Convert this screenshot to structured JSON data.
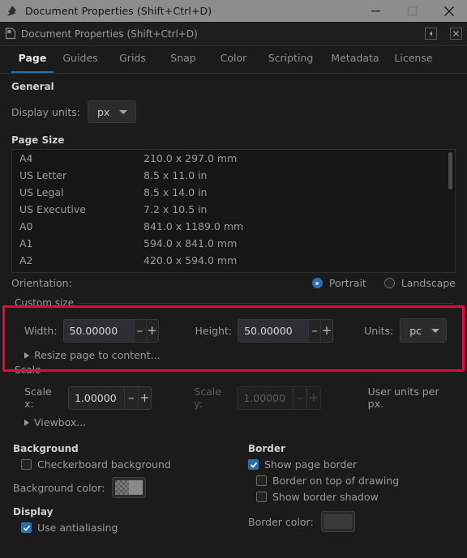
{
  "window": {
    "title": "Document Properties (Shift+Ctrl+D)",
    "icon": "inkscape-logo-icon",
    "minimize_label": "Minimize",
    "maximize_label": "Maximize",
    "close_label": "Close"
  },
  "dialog_header": {
    "icon": "document-properties-icon",
    "title": "Document Properties (Shift+Ctrl+D)",
    "dock_button": "collapse-panel-icon",
    "close_button": "close-panel-icon"
  },
  "tabs": [
    {
      "label": "Page",
      "active": true
    },
    {
      "label": "Guides",
      "active": false
    },
    {
      "label": "Grids",
      "active": false
    },
    {
      "label": "Snap",
      "active": false
    },
    {
      "label": "Color",
      "active": false
    },
    {
      "label": "Scripting",
      "active": false
    },
    {
      "label": "Metadata",
      "active": false
    },
    {
      "label": "License",
      "active": false
    }
  ],
  "general": {
    "title": "General",
    "display_units_label": "Display units:",
    "display_units_value": "px"
  },
  "page_size": {
    "title": "Page Size",
    "rows": [
      {
        "name": "A4",
        "dimensions": "210.0 x 297.0 mm"
      },
      {
        "name": "US Letter",
        "dimensions": "8.5 x 11.0 in"
      },
      {
        "name": "US Legal",
        "dimensions": "8.5 x 14.0 in"
      },
      {
        "name": "US Executive",
        "dimensions": "7.2 x 10.5 in"
      },
      {
        "name": "A0",
        "dimensions": "841.0 x 1189.0 mm"
      },
      {
        "name": "A1",
        "dimensions": "594.0 x 841.0 mm"
      },
      {
        "name": "A2",
        "dimensions": "420.0 x 594.0 mm"
      }
    ]
  },
  "orientation": {
    "label": "Orientation:",
    "portrait_label": "Portrait",
    "landscape_label": "Landscape",
    "selected": "Portrait"
  },
  "custom_size": {
    "title": "Custom size",
    "width_label": "Width:",
    "width_value": "50.00000",
    "height_label": "Height:",
    "height_value": "50.00000",
    "units_label": "Units:",
    "units_value": "pc",
    "minus_label": "–",
    "plus_label": "+",
    "resize_to_content_label": "Resize page to content...",
    "highlighted": true,
    "highlight_color": "#f0023a"
  },
  "scale": {
    "title": "Scale",
    "scale_x_label": "Scale x:",
    "scale_x_value": "1.00000",
    "scale_y_label": "Scale y:",
    "scale_y_value": "1.00000",
    "units_note": "User units per px.",
    "viewbox_label": "Viewbox...",
    "minus_label": "–",
    "plus_label": "+"
  },
  "background": {
    "title": "Background",
    "checkerboard_label": "Checkerboard background",
    "checkerboard_checked": false,
    "color_label": "Background color:",
    "color_swatch": "checkerboard-gray-swatch"
  },
  "display": {
    "title": "Display",
    "antialiasing_label": "Use antialiasing",
    "antialiasing_checked": true
  },
  "border": {
    "title": "Border",
    "show_page_border_label": "Show page border",
    "show_page_border_checked": true,
    "border_on_top_label": "Border on top of drawing",
    "border_on_top_checked": false,
    "show_border_shadow_label": "Show border shadow",
    "show_border_shadow_checked": false,
    "color_label": "Border color:",
    "color_swatch": "dark-gray-swatch"
  },
  "theme": {
    "accent": "#2a6fb0",
    "panel_bg": "#1b1b1b",
    "titlebar_bg": "#8d8d8d",
    "text": "#9a9a9a"
  }
}
